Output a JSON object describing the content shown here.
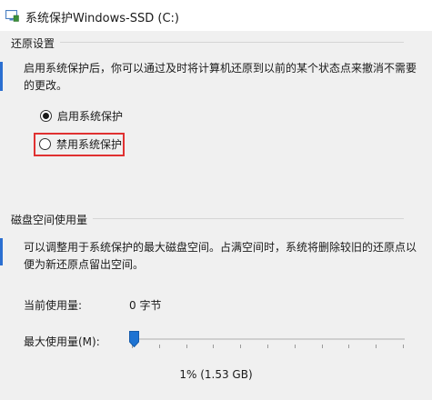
{
  "window": {
    "title": "系统保护Windows-SSD (C:)",
    "icon": "shield-settings-icon"
  },
  "restore_settings": {
    "group_label": "还原设置",
    "description_line1": "启用系统保护后，你可以通过及时将计算机还原到以前的某个状态点来撤消不需要",
    "description_line2": "的更改。",
    "options": [
      {
        "label": "启用系统保护",
        "checked": true
      },
      {
        "label": "禁用系统保护",
        "checked": false
      }
    ],
    "highlight_color": "#e03131"
  },
  "disk_usage": {
    "group_label": "磁盘空间使用量",
    "description_line1": "可以调整用于系统保护的最大磁盘空间。占满空间时，系统将删除较旧的还原点以",
    "description_line2": "便为新还原点留出空间。",
    "current_label": "当前使用量:",
    "current_value": "0 字节",
    "max_label": "最大使用量(M):",
    "max_fraction": 0.01,
    "max_value_text": "1% (1.53 GB)",
    "accent_color": "#1e73d2"
  }
}
